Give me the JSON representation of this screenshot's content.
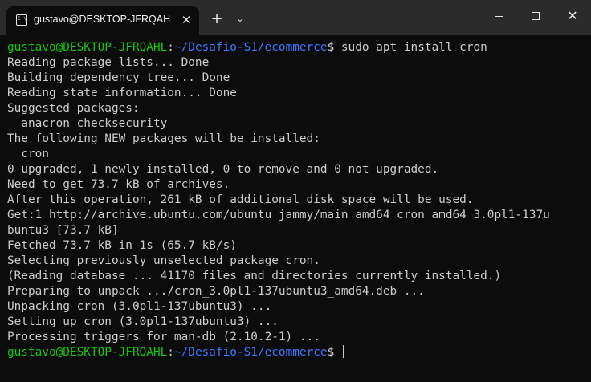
{
  "window": {
    "tab_title": "gustavo@DESKTOP-JFRQAHL:",
    "tab_icon_label": "C:\\",
    "close_glyph": "✕",
    "new_tab_glyph": "+",
    "dropdown_glyph": "⌄",
    "close_window_glyph": "✕"
  },
  "prompt": {
    "user_host": "gustavo@DESKTOP-JFRQAHL",
    "path": "~/Desafio-S1/ecommerce",
    "command": "sudo apt install cron"
  },
  "terminal": {
    "output": [
      "Reading package lists... Done",
      "Building dependency tree... Done",
      "Reading state information... Done",
      "Suggested packages:",
      "  anacron checksecurity",
      "The following NEW packages will be installed:",
      "  cron",
      "0 upgraded, 1 newly installed, 0 to remove and 0 not upgraded.",
      "Need to get 73.7 kB of archives.",
      "After this operation, 261 kB of additional disk space will be used.",
      "Get:1 http://archive.ubuntu.com/ubuntu jammy/main amd64 cron amd64 3.0pl1-137u",
      "buntu3 [73.7 kB]",
      "Fetched 73.7 kB in 1s (65.7 kB/s)",
      "Selecting previously unselected package cron.",
      "(Reading database ... 41170 files and directories currently installed.)",
      "Preparing to unpack .../cron_3.0pl1-137ubuntu3_amd64.deb ...",
      "Unpacking cron (3.0pl1-137ubuntu3) ...",
      "Setting up cron (3.0pl1-137ubuntu3) ...",
      "Processing triggers for man-db (2.10.2-1) ..."
    ]
  },
  "colors": {
    "background": "#0c0c0c",
    "titlebar": "#2b2b2b",
    "text": "#cccccc",
    "user": "#16c60c",
    "path": "#3b78ff"
  },
  "icons": [
    "terminal-icon",
    "close-icon",
    "plus-icon",
    "chevron-down-icon",
    "minimize-icon",
    "maximize-icon",
    "window-close-icon"
  ]
}
